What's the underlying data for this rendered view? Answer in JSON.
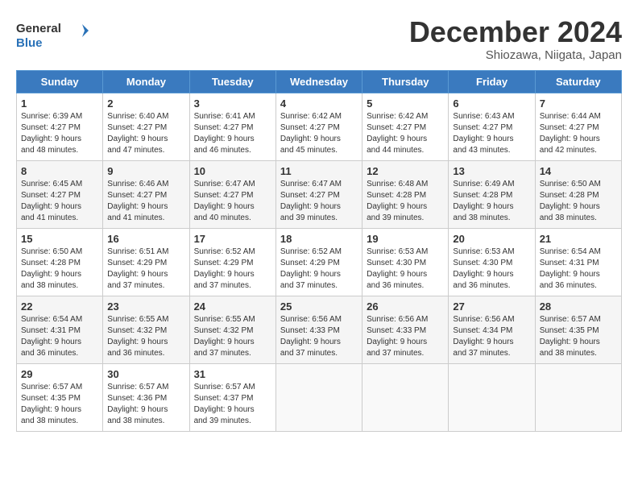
{
  "header": {
    "logo_text_general": "General",
    "logo_text_blue": "Blue",
    "month_title": "December 2024",
    "subtitle": "Shiozawa, Niigata, Japan"
  },
  "weekdays": [
    "Sunday",
    "Monday",
    "Tuesday",
    "Wednesday",
    "Thursday",
    "Friday",
    "Saturday"
  ],
  "weeks": [
    [
      {
        "day": "1",
        "info": "Sunrise: 6:39 AM\nSunset: 4:27 PM\nDaylight: 9 hours\nand 48 minutes."
      },
      {
        "day": "2",
        "info": "Sunrise: 6:40 AM\nSunset: 4:27 PM\nDaylight: 9 hours\nand 47 minutes."
      },
      {
        "day": "3",
        "info": "Sunrise: 6:41 AM\nSunset: 4:27 PM\nDaylight: 9 hours\nand 46 minutes."
      },
      {
        "day": "4",
        "info": "Sunrise: 6:42 AM\nSunset: 4:27 PM\nDaylight: 9 hours\nand 45 minutes."
      },
      {
        "day": "5",
        "info": "Sunrise: 6:42 AM\nSunset: 4:27 PM\nDaylight: 9 hours\nand 44 minutes."
      },
      {
        "day": "6",
        "info": "Sunrise: 6:43 AM\nSunset: 4:27 PM\nDaylight: 9 hours\nand 43 minutes."
      },
      {
        "day": "7",
        "info": "Sunrise: 6:44 AM\nSunset: 4:27 PM\nDaylight: 9 hours\nand 42 minutes."
      }
    ],
    [
      {
        "day": "8",
        "info": "Sunrise: 6:45 AM\nSunset: 4:27 PM\nDaylight: 9 hours\nand 41 minutes."
      },
      {
        "day": "9",
        "info": "Sunrise: 6:46 AM\nSunset: 4:27 PM\nDaylight: 9 hours\nand 41 minutes."
      },
      {
        "day": "10",
        "info": "Sunrise: 6:47 AM\nSunset: 4:27 PM\nDaylight: 9 hours\nand 40 minutes."
      },
      {
        "day": "11",
        "info": "Sunrise: 6:47 AM\nSunset: 4:27 PM\nDaylight: 9 hours\nand 39 minutes."
      },
      {
        "day": "12",
        "info": "Sunrise: 6:48 AM\nSunset: 4:28 PM\nDaylight: 9 hours\nand 39 minutes."
      },
      {
        "day": "13",
        "info": "Sunrise: 6:49 AM\nSunset: 4:28 PM\nDaylight: 9 hours\nand 38 minutes."
      },
      {
        "day": "14",
        "info": "Sunrise: 6:50 AM\nSunset: 4:28 PM\nDaylight: 9 hours\nand 38 minutes."
      }
    ],
    [
      {
        "day": "15",
        "info": "Sunrise: 6:50 AM\nSunset: 4:28 PM\nDaylight: 9 hours\nand 38 minutes."
      },
      {
        "day": "16",
        "info": "Sunrise: 6:51 AM\nSunset: 4:29 PM\nDaylight: 9 hours\nand 37 minutes."
      },
      {
        "day": "17",
        "info": "Sunrise: 6:52 AM\nSunset: 4:29 PM\nDaylight: 9 hours\nand 37 minutes."
      },
      {
        "day": "18",
        "info": "Sunrise: 6:52 AM\nSunset: 4:29 PM\nDaylight: 9 hours\nand 37 minutes."
      },
      {
        "day": "19",
        "info": "Sunrise: 6:53 AM\nSunset: 4:30 PM\nDaylight: 9 hours\nand 36 minutes."
      },
      {
        "day": "20",
        "info": "Sunrise: 6:53 AM\nSunset: 4:30 PM\nDaylight: 9 hours\nand 36 minutes."
      },
      {
        "day": "21",
        "info": "Sunrise: 6:54 AM\nSunset: 4:31 PM\nDaylight: 9 hours\nand 36 minutes."
      }
    ],
    [
      {
        "day": "22",
        "info": "Sunrise: 6:54 AM\nSunset: 4:31 PM\nDaylight: 9 hours\nand 36 minutes."
      },
      {
        "day": "23",
        "info": "Sunrise: 6:55 AM\nSunset: 4:32 PM\nDaylight: 9 hours\nand 36 minutes."
      },
      {
        "day": "24",
        "info": "Sunrise: 6:55 AM\nSunset: 4:32 PM\nDaylight: 9 hours\nand 37 minutes."
      },
      {
        "day": "25",
        "info": "Sunrise: 6:56 AM\nSunset: 4:33 PM\nDaylight: 9 hours\nand 37 minutes."
      },
      {
        "day": "26",
        "info": "Sunrise: 6:56 AM\nSunset: 4:33 PM\nDaylight: 9 hours\nand 37 minutes."
      },
      {
        "day": "27",
        "info": "Sunrise: 6:56 AM\nSunset: 4:34 PM\nDaylight: 9 hours\nand 37 minutes."
      },
      {
        "day": "28",
        "info": "Sunrise: 6:57 AM\nSunset: 4:35 PM\nDaylight: 9 hours\nand 38 minutes."
      }
    ],
    [
      {
        "day": "29",
        "info": "Sunrise: 6:57 AM\nSunset: 4:35 PM\nDaylight: 9 hours\nand 38 minutes."
      },
      {
        "day": "30",
        "info": "Sunrise: 6:57 AM\nSunset: 4:36 PM\nDaylight: 9 hours\nand 38 minutes."
      },
      {
        "day": "31",
        "info": "Sunrise: 6:57 AM\nSunset: 4:37 PM\nDaylight: 9 hours\nand 39 minutes."
      },
      {
        "day": "",
        "info": ""
      },
      {
        "day": "",
        "info": ""
      },
      {
        "day": "",
        "info": ""
      },
      {
        "day": "",
        "info": ""
      }
    ]
  ]
}
